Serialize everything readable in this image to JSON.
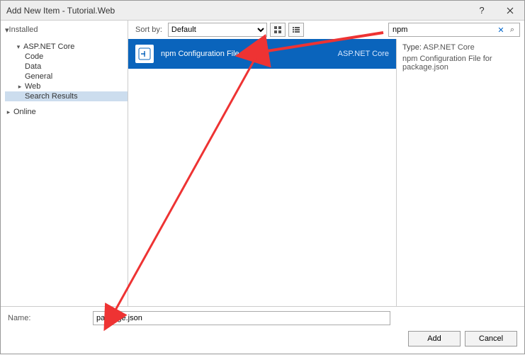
{
  "window": {
    "title": "Add New Item - Tutorial.Web"
  },
  "sidebar_top": {
    "label": "Installed",
    "expanded": true
  },
  "tree": {
    "root": "ASP.NET Core",
    "items": [
      "Code",
      "Data",
      "General",
      "Web",
      "Search Results"
    ],
    "online": "Online"
  },
  "toolbar": {
    "sort_label": "Sort by:",
    "sort_value": "Default",
    "search_value": "npm"
  },
  "template": {
    "name": "npm Configuration File",
    "tag": "ASP.NET Core"
  },
  "details": {
    "type_label": "Type:",
    "type_value": "ASP.NET Core",
    "desc": "npm Configuration File for package.json"
  },
  "footer": {
    "name_label": "Name:",
    "name_value": "package.json",
    "add": "Add",
    "cancel": "Cancel"
  }
}
